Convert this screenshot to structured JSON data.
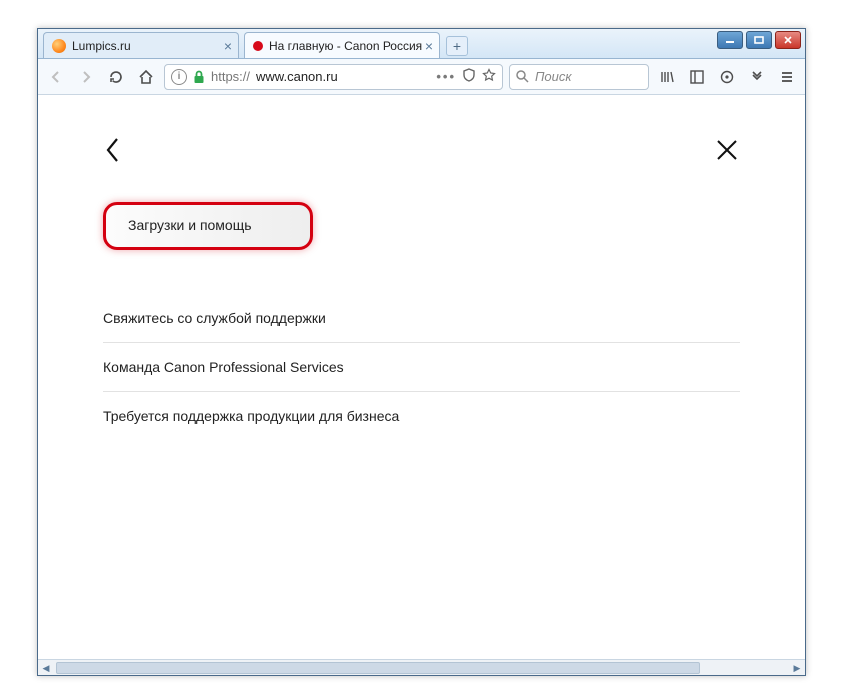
{
  "tabs": [
    {
      "title": "Lumpics.ru",
      "favicon": "orange",
      "active": false
    },
    {
      "title": "На главную - Canon Россия",
      "favicon": "red",
      "active": true
    }
  ],
  "url": {
    "scheme": "https://",
    "domain": "www.canon.ru"
  },
  "search": {
    "placeholder": "Поиск"
  },
  "menu": {
    "highlight": "Загрузки и помощь",
    "items": [
      "Свяжитесь со службой поддержки",
      "Команда Canon Professional Services",
      "Требуется поддержка продукции для бизнеса"
    ]
  },
  "colors": {
    "accent_red": "#d40010",
    "lock_green": "#2fa84f"
  }
}
